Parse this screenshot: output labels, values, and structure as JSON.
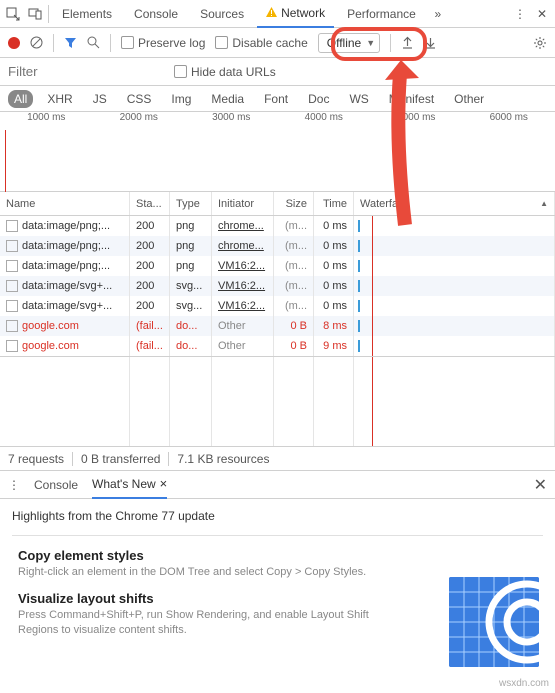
{
  "tabs": {
    "elements": "Elements",
    "console": "Console",
    "sources": "Sources",
    "network": "Network",
    "performance": "Performance"
  },
  "toolbar": {
    "preserve_log": "Preserve log",
    "disable_cache": "Disable cache",
    "throttle": "Offline"
  },
  "filter": {
    "placeholder": "Filter",
    "hide_data_urls": "Hide data URLs",
    "types": [
      "All",
      "XHR",
      "JS",
      "CSS",
      "Img",
      "Media",
      "Font",
      "Doc",
      "WS",
      "Manifest",
      "Other"
    ]
  },
  "timeline": {
    "ticks": [
      "1000 ms",
      "2000 ms",
      "3000 ms",
      "4000 ms",
      "5000 ms",
      "6000 ms"
    ]
  },
  "headers": {
    "name": "Name",
    "status": "Sta...",
    "type": "Type",
    "initiator": "Initiator",
    "size": "Size",
    "time": "Time",
    "waterfall": "Waterfall"
  },
  "rows": [
    {
      "name": "data:image/png;...",
      "status": "200",
      "type": "png",
      "initiator": "chrome...",
      "size": "(m...",
      "time": "0 ms",
      "failed": false,
      "link": true
    },
    {
      "name": "data:image/png;...",
      "status": "200",
      "type": "png",
      "initiator": "chrome...",
      "size": "(m...",
      "time": "0 ms",
      "failed": false,
      "link": true
    },
    {
      "name": "data:image/png;...",
      "status": "200",
      "type": "png",
      "initiator": "VM16:2...",
      "size": "(m...",
      "time": "0 ms",
      "failed": false,
      "link": true
    },
    {
      "name": "data:image/svg+...",
      "status": "200",
      "type": "svg...",
      "initiator": "VM16:2...",
      "size": "(m...",
      "time": "0 ms",
      "failed": false,
      "link": true
    },
    {
      "name": "data:image/svg+...",
      "status": "200",
      "type": "svg...",
      "initiator": "VM16:2...",
      "size": "(m...",
      "time": "0 ms",
      "failed": false,
      "link": true
    },
    {
      "name": "google.com",
      "status": "(fail...",
      "type": "do...",
      "initiator": "Other",
      "size": "0 B",
      "time": "8 ms",
      "failed": true,
      "link": false
    },
    {
      "name": "google.com",
      "status": "(fail...",
      "type": "do...",
      "initiator": "Other",
      "size": "0 B",
      "time": "9 ms",
      "failed": true,
      "link": false
    }
  ],
  "summary": {
    "requests": "7 requests",
    "transferred": "0 B transferred",
    "resources": "7.1 KB resources"
  },
  "drawer": {
    "console": "Console",
    "whatsnew": "What's New",
    "heading": "Highlights from the Chrome 77 update",
    "features": [
      {
        "title": "Copy element styles",
        "desc": "Right-click an element in the DOM Tree and select Copy > Copy Styles."
      },
      {
        "title": "Visualize layout shifts",
        "desc": "Press Command+Shift+P, run Show Rendering, and enable Layout Shift Regions to visualize content shifts."
      }
    ]
  },
  "watermark": "wsxdn.com"
}
